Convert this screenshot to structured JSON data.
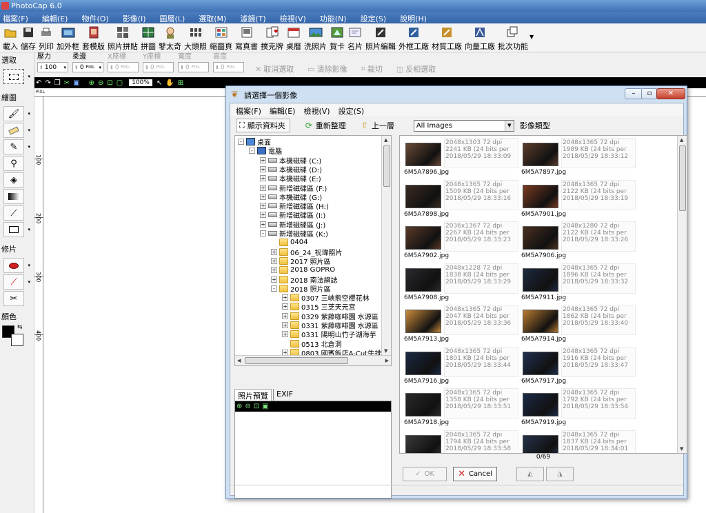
{
  "app": {
    "title": "PhotoCap 6.0"
  },
  "menu": [
    "檔案(F)",
    "編輯(E)",
    "物件(O)",
    "影像(I)",
    "圖層(L)",
    "選取(M)",
    "濾鏡(T)",
    "檢視(V)",
    "功能(N)",
    "設定(S)",
    "說明(H)"
  ],
  "toolbar": [
    "載入",
    "儲存",
    "列印",
    "加外框",
    "套模版",
    "照片拼貼",
    "拼圖",
    "鼕太奇",
    "大頭照",
    "縮圖頁",
    "寫真書",
    "撲克牌",
    "桌曆",
    "洗照片",
    "賀卡",
    "名片",
    "照片編輯",
    "外框工廠",
    "材質工廠",
    "向量工廠",
    "批次功能"
  ],
  "options": {
    "pressure": {
      "label": "壓力",
      "value": "100"
    },
    "softedge": {
      "label": "柔邊",
      "value": "0"
    },
    "x": {
      "label": "X座標",
      "value": "0"
    },
    "y": {
      "label": "Y座標",
      "value": "0"
    },
    "width": {
      "label": "寬度",
      "value": "0"
    },
    "height": {
      "label": "高度",
      "value": "0"
    },
    "unit": "PIXL",
    "cancel_select": "取消選取",
    "clear_image": "清除影像",
    "crop": "裁切",
    "invert_select": "反相選取"
  },
  "left_panel": {
    "select": "選取",
    "draw": "繪圖",
    "retouch": "修片",
    "color": "顏色"
  },
  "canvas": {
    "zoom": "100%",
    "ruler_unit": "PIXL",
    "vruler": [
      "100",
      "200",
      "300",
      "400"
    ]
  },
  "dialog": {
    "title": "請選擇一個影像",
    "menu": [
      "檔案(F)",
      "編輯(E)",
      "檢視(V)",
      "設定(S)"
    ],
    "show_folders": "顯示資料夾",
    "refresh": "重新整理",
    "up_level": "上一層",
    "filter": "All Images",
    "image_type": "影像類型",
    "tree": [
      {
        "label": "桌面",
        "depth": 0,
        "exp": "-",
        "icon": "desk"
      },
      {
        "label": "電腦",
        "depth": 1,
        "exp": "-",
        "icon": "pc"
      },
      {
        "label": "本機磁碟 (C:)",
        "depth": 2,
        "exp": "+",
        "icon": "drive"
      },
      {
        "label": "本機磁碟 (D:)",
        "depth": 2,
        "exp": "+",
        "icon": "drive"
      },
      {
        "label": "本機磁碟 (E:)",
        "depth": 2,
        "exp": "+",
        "icon": "drive"
      },
      {
        "label": "新增磁碟區 (F:)",
        "depth": 2,
        "exp": "+",
        "icon": "drive"
      },
      {
        "label": "本機磁碟 (G:)",
        "depth": 2,
        "exp": "+",
        "icon": "drive"
      },
      {
        "label": "新增磁碟區 (H:)",
        "depth": 2,
        "exp": "+",
        "icon": "drive"
      },
      {
        "label": "新增磁碟區 (I:)",
        "depth": 2,
        "exp": "+",
        "icon": "drive"
      },
      {
        "label": "新增磁碟區 (J:)",
        "depth": 2,
        "exp": "+",
        "icon": "drive"
      },
      {
        "label": "新增磁碟區 (K:)",
        "depth": 2,
        "exp": "-",
        "icon": "drive"
      },
      {
        "label": "0404",
        "depth": 3,
        "exp": "",
        "icon": "folder"
      },
      {
        "label": "06_24_祝瑋照片",
        "depth": 3,
        "exp": "+",
        "icon": "folder"
      },
      {
        "label": "2017 照片區",
        "depth": 3,
        "exp": "+",
        "icon": "folder"
      },
      {
        "label": "2018 GOPRO",
        "depth": 3,
        "exp": "+",
        "icon": "folder"
      },
      {
        "label": "2018 南法網誌",
        "depth": 3,
        "exp": "+",
        "icon": "folder"
      },
      {
        "label": "2018 照片區",
        "depth": 3,
        "exp": "-",
        "icon": "folder"
      },
      {
        "label": "0307 三峽熊空櫻花林",
        "depth": 4,
        "exp": "+",
        "icon": "folder"
      },
      {
        "label": "0315 三芝天元宮",
        "depth": 4,
        "exp": "+",
        "icon": "folder"
      },
      {
        "label": "0329 紫藤咖啡園 水源區",
        "depth": 4,
        "exp": "+",
        "icon": "folder"
      },
      {
        "label": "0331 紫藤咖啡園 水源區",
        "depth": 4,
        "exp": "+",
        "icon": "folder"
      },
      {
        "label": "0331 陽明山竹子湖海芋",
        "depth": 4,
        "exp": "+",
        "icon": "folder"
      },
      {
        "label": "0513 北倉洞",
        "depth": 4,
        "exp": "",
        "icon": "folder"
      },
      {
        "label": "0803 國賓飯店A-Cut牛排",
        "depth": 4,
        "exp": "+",
        "icon": "folder"
      }
    ],
    "preview_tabs": [
      "照片預覽",
      "EXIF"
    ],
    "thumbs": [
      {
        "name": "6M5A7896.jpg",
        "dims": "2048x1303 72 dpi",
        "size": "2241 KB (24 bits per",
        "date": "2018/05/29 18:33:09",
        "color": "#6a4a36"
      },
      {
        "name": "6M5A7897.jpg",
        "dims": "2048x1365 72 dpi",
        "size": "1989 KB (24 bits per",
        "date": "2018/05/29 18:33:12",
        "color": "#5b3c2a"
      },
      {
        "name": "6M5A7898.jpg",
        "dims": "2048x1365 72 dpi",
        "size": "1509 KB (24 bits per",
        "date": "2018/05/29 18:33:16",
        "color": "#3b2a22"
      },
      {
        "name": "6M5A7901.jpg",
        "dims": "2048x1365 72 dpi",
        "size": "2122 KB (24 bits per",
        "date": "2018/05/29 18:33:19",
        "color": "#7a3a20"
      },
      {
        "name": "6M5A7902.jpg",
        "dims": "2036x1367 72 dpi",
        "size": "2267 KB (24 bits per",
        "date": "2018/05/29 18:33:23",
        "color": "#5a3a28"
      },
      {
        "name": "6M5A7906.jpg",
        "dims": "2048x1280 72 dpi",
        "size": "2122 KB (24 bits per",
        "date": "2018/05/29 18:33:26",
        "color": "#4a3020"
      },
      {
        "name": "6M5A7908.jpg",
        "dims": "2048x1228 72 dpi",
        "size": "1838 KB (24 bits per",
        "date": "2018/05/29 18:33:29",
        "color": "#2a2a30"
      },
      {
        "name": "6M5A7911.jpg",
        "dims": "2048x1365 72 dpi",
        "size": "1896 KB (24 bits per",
        "date": "2018/05/29 18:33:32",
        "color": "#1d2a40"
      },
      {
        "name": "6M5A7913.jpg",
        "dims": "2048x1365 72 dpi",
        "size": "2047 KB (24 bits per",
        "date": "2018/05/29 18:33:36",
        "color": "#c98a3a"
      },
      {
        "name": "6M5A7914.jpg",
        "dims": "2048x1365 72 dpi",
        "size": "1862 KB (24 bits per",
        "date": "2018/05/29 18:33:40",
        "color": "#b87a30"
      },
      {
        "name": "6M5A7916.jpg",
        "dims": "2048x1365 72 dpi",
        "size": "1801 KB (24 bits per",
        "date": "2018/05/29 18:33:44",
        "color": "#1a2a44"
      },
      {
        "name": "6M5A7917.jpg",
        "dims": "2048x1365 72 dpi",
        "size": "1916 KB (24 bits per",
        "date": "2018/05/29 18:33:47",
        "color": "#203050"
      },
      {
        "name": "6M5A7918.jpg",
        "dims": "2048x1365 72 dpi",
        "size": "1358 KB (24 bits per",
        "date": "2018/05/29 18:33:51",
        "color": "#2a2a2a"
      },
      {
        "name": "6M5A7919.jpg",
        "dims": "2048x1365 72 dpi",
        "size": "1792 KB (24 bits per",
        "date": "2018/05/29 18:33:54",
        "color": "#1a2a46"
      },
      {
        "name": "",
        "dims": "2048x1365 72 dpi",
        "size": "1794 KB (24 bits per",
        "date": "2018/05/29 18:33:58",
        "color": "#3a3a3a"
      },
      {
        "name": "",
        "dims": "2048x1365 72 dpi",
        "size": "1837 KB (24 bits per",
        "date": "2018/05/29 18:34:01",
        "color": "#26324a"
      }
    ],
    "counter": "0/69",
    "ok": "OK",
    "cancel": "Cancel"
  }
}
